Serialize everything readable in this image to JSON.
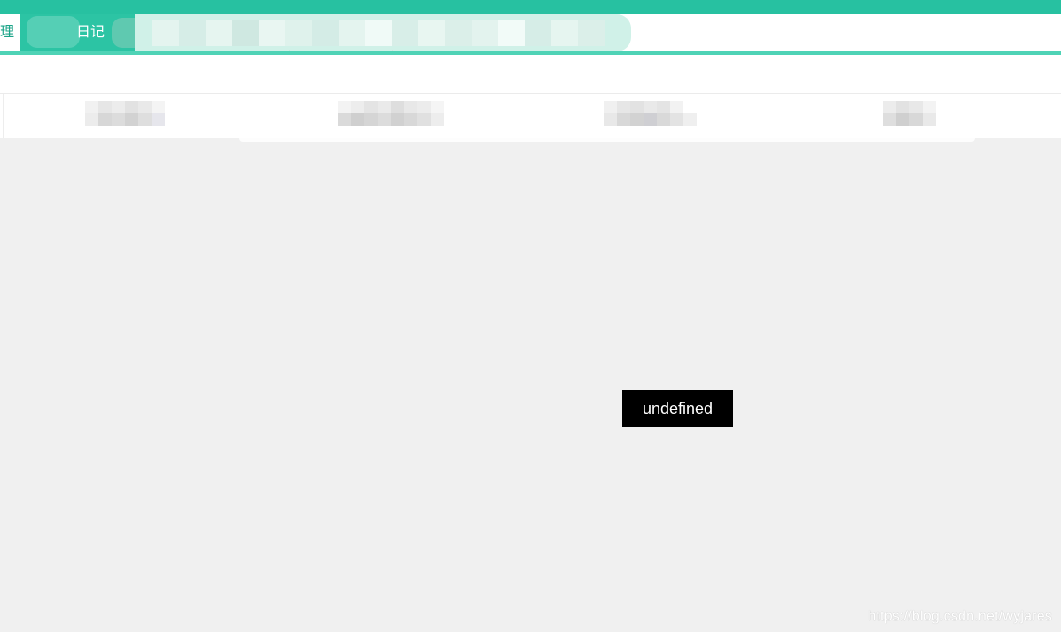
{
  "tabs": {
    "left_label": "理",
    "active_label": "日记"
  },
  "toast": {
    "text": "undefined"
  },
  "watermark": {
    "text": "https://blog.csdn.net/wyjares"
  },
  "colors": {
    "accent": "#27c1a1",
    "active_tab": "#2cc4a4",
    "page_background": "#f0f0f0",
    "toast_background": "#000000"
  }
}
